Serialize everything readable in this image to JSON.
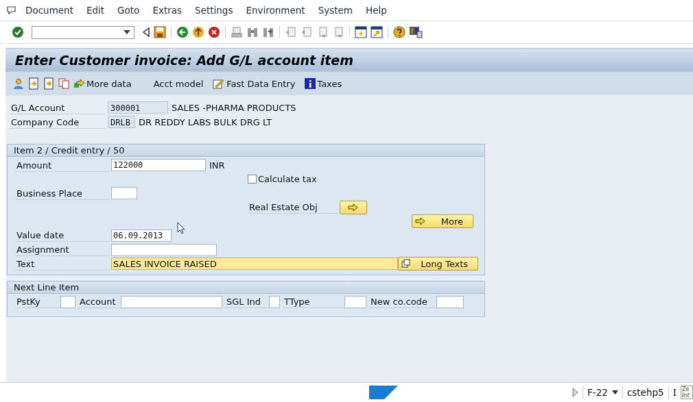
{
  "menu": [
    "Document",
    "Edit",
    "Goto",
    "Extras",
    "Settings",
    "Environment",
    "System",
    "Help"
  ],
  "title": "Enter Customer invoice: Add G/L account item",
  "app_toolbar": [
    {
      "kind": "icon"
    },
    {
      "kind": "icon"
    },
    {
      "kind": "icon"
    },
    {
      "kind": "icon"
    },
    {
      "kind": "button",
      "label": "More data"
    },
    {
      "kind": "button",
      "label": "Acct model"
    },
    {
      "kind": "button",
      "label": "Fast Data Entry"
    },
    {
      "kind": "button",
      "label": "Taxes"
    }
  ],
  "header_fields": [
    {
      "label": "G/L Account",
      "value": "300001",
      "description": "SALES -PHARMA PRODUCTS"
    },
    {
      "label": "Company Code",
      "value": "DRLB",
      "description": "DR REDDY LABS BULK DRG LT"
    }
  ],
  "item_group": {
    "title": "Item 2 / Credit entry / 50",
    "amount": {
      "label": "Amount",
      "value": "122000",
      "unit": "INR"
    },
    "calculate_tax": {
      "label": "Calculate tax",
      "checked": false
    },
    "business_place": {
      "label": "Business Place"
    },
    "real_estate": {
      "label": "Real Estate Obj"
    },
    "more_button": "More",
    "value_date": {
      "label": "Value date",
      "value": "06.09.2013"
    },
    "assignment": {
      "label": "Assignment"
    },
    "text": {
      "label": "Text",
      "value": "SALES INVOICE RAISED"
    },
    "long_texts_button": "Long Texts"
  },
  "next_line_item": {
    "title": "Next Line Item",
    "fields": [
      {
        "label": "PstKy"
      },
      {
        "label": "Account"
      },
      {
        "label": "SGL Ind"
      },
      {
        "label": "TType"
      },
      {
        "label": "New co.code"
      }
    ]
  },
  "status_bar": {
    "transaction": "F-22",
    "server": "cstehp5",
    "client": "I",
    "tooltip": [
      "Ze",
      "Int"
    ]
  }
}
